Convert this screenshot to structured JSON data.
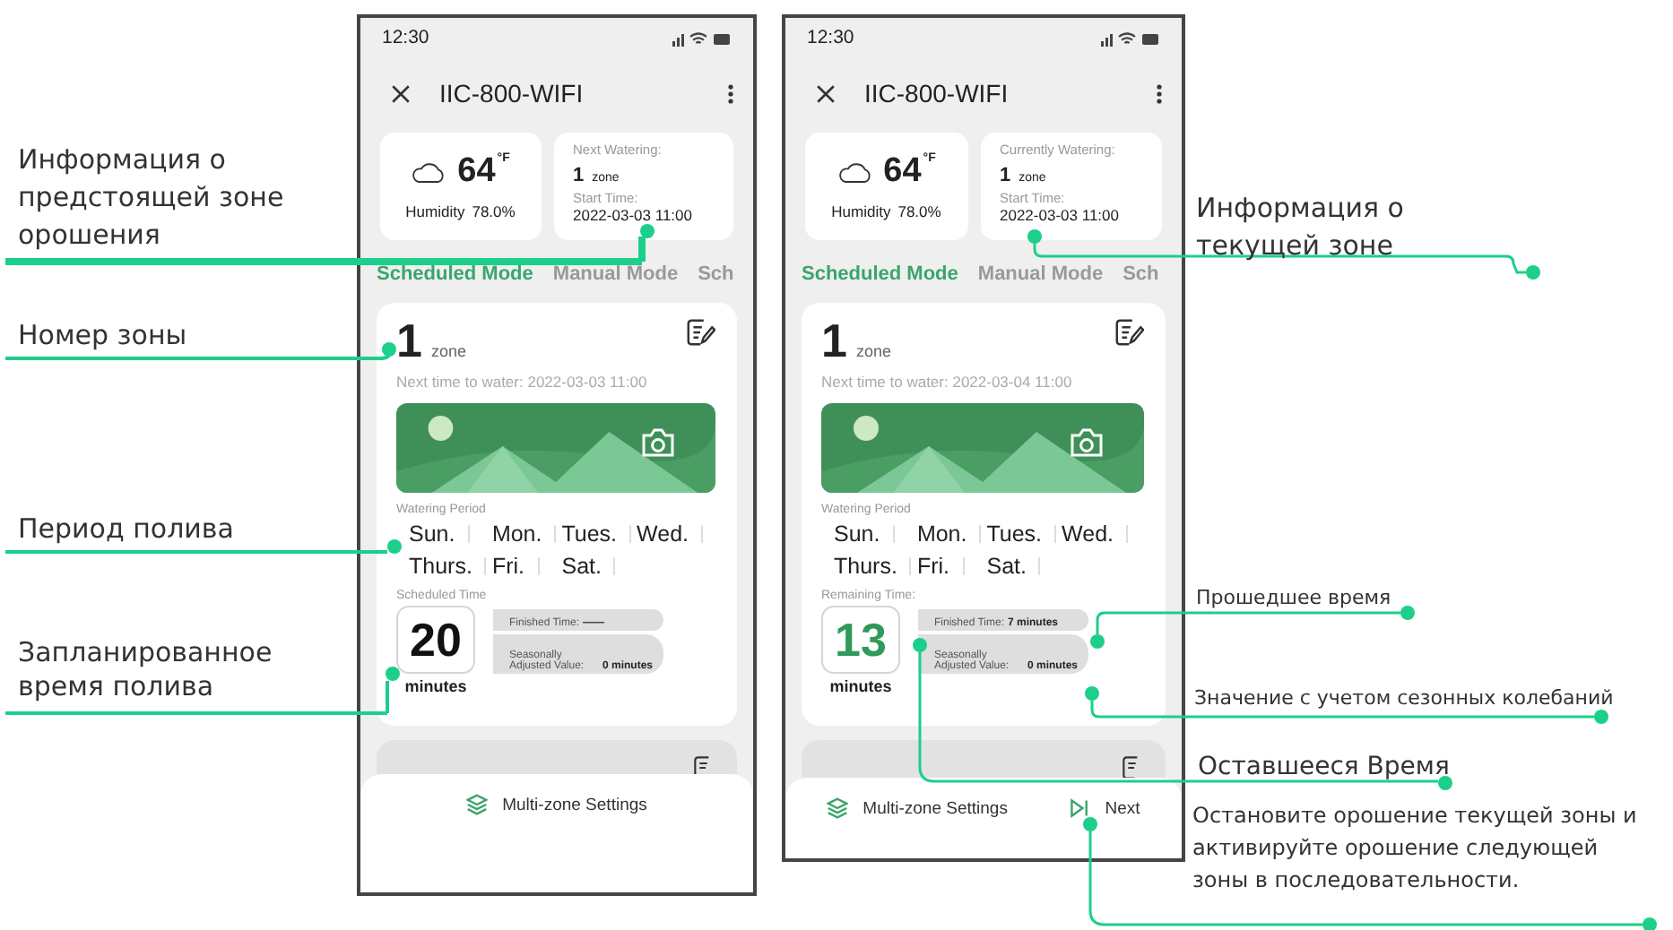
{
  "screens": [
    {
      "status_time": "12:30",
      "title": "IIC-800-WIFI",
      "weather": {
        "temp": "64",
        "unit": "°F",
        "humidity_label": "Humidity",
        "humidity": "78.0%"
      },
      "info": {
        "label": "Next Watering:",
        "zone_number": "1",
        "zone_unit": "zone",
        "start_label": "Start Time:",
        "start_time": "2022-03-03 11:00"
      },
      "tabs": [
        {
          "label": "Scheduled Mode",
          "selected": true
        },
        {
          "label": "Manual Mode",
          "selected": false
        },
        {
          "label": "Sch",
          "selected": false
        }
      ],
      "zone": {
        "number": "1",
        "unit": "zone",
        "next_time": "Next time to water: 2022-03-03 11:00",
        "period_label": "Watering Period",
        "days": [
          "Sun.",
          "Mon.",
          "Tues.",
          "Wed.",
          "Thurs.",
          "Fri.",
          "Sat."
        ],
        "time_label": "Scheduled Time",
        "time": {
          "value": "20",
          "unit": "minutes",
          "color": "#111111"
        },
        "finished_label": "Finished Time:",
        "finished_value": "——",
        "seasonal_label": "Seasonally Adjusted Value:",
        "seasonal_value": "0 minutes"
      },
      "actions": [
        {
          "kind": "layers",
          "label": "Multi-zone Settings"
        }
      ]
    },
    {
      "status_time": "12:30",
      "title": "IIC-800-WIFI",
      "weather": {
        "temp": "64",
        "unit": "°F",
        "humidity_label": "Humidity",
        "humidity": "78.0%"
      },
      "info": {
        "label": "Currently Watering:",
        "zone_number": "1",
        "zone_unit": "zone",
        "start_label": "Start Time:",
        "start_time": "2022-03-03 11:00"
      },
      "tabs": [
        {
          "label": "Scheduled Mode",
          "selected": true
        },
        {
          "label": "Manual Mode",
          "selected": false
        },
        {
          "label": "Sch",
          "selected": false
        }
      ],
      "zone": {
        "number": "1",
        "unit": "zone",
        "next_time": "Next time to water: 2022-03-04 11:00",
        "period_label": "Watering Period",
        "days": [
          "Sun.",
          "Mon.",
          "Tues.",
          "Wed.",
          "Thurs.",
          "Fri.",
          "Sat."
        ],
        "time_label": "Remaining Time:",
        "time": {
          "value": "13",
          "unit": "minutes",
          "color": "#2f9a5a"
        },
        "finished_label": "Finished Time:",
        "finished_value": "7 minutes",
        "seasonal_label": "Seasonally Adjusted Value:",
        "seasonal_value": "0 minutes"
      },
      "actions": [
        {
          "kind": "layers",
          "label": "Multi-zone Settings"
        },
        {
          "kind": "next",
          "label": "Next"
        }
      ]
    }
  ],
  "annotations": [
    {
      "text": "Информация о предстоящей зоне орошения"
    },
    {
      "text": "Номер зоны"
    },
    {
      "text": "Период полива"
    },
    {
      "text": "Запланированное время полива"
    },
    {
      "text": "Информация о текущей зоне"
    },
    {
      "text": "Прошедшее время"
    },
    {
      "text": "Значение с учетом сезонных колебаний"
    },
    {
      "text": "Оставшееся Время"
    },
    {
      "text": "Остановите орошение текущей зоны и активируйте орошение следующей зоны в последовательности."
    }
  ]
}
